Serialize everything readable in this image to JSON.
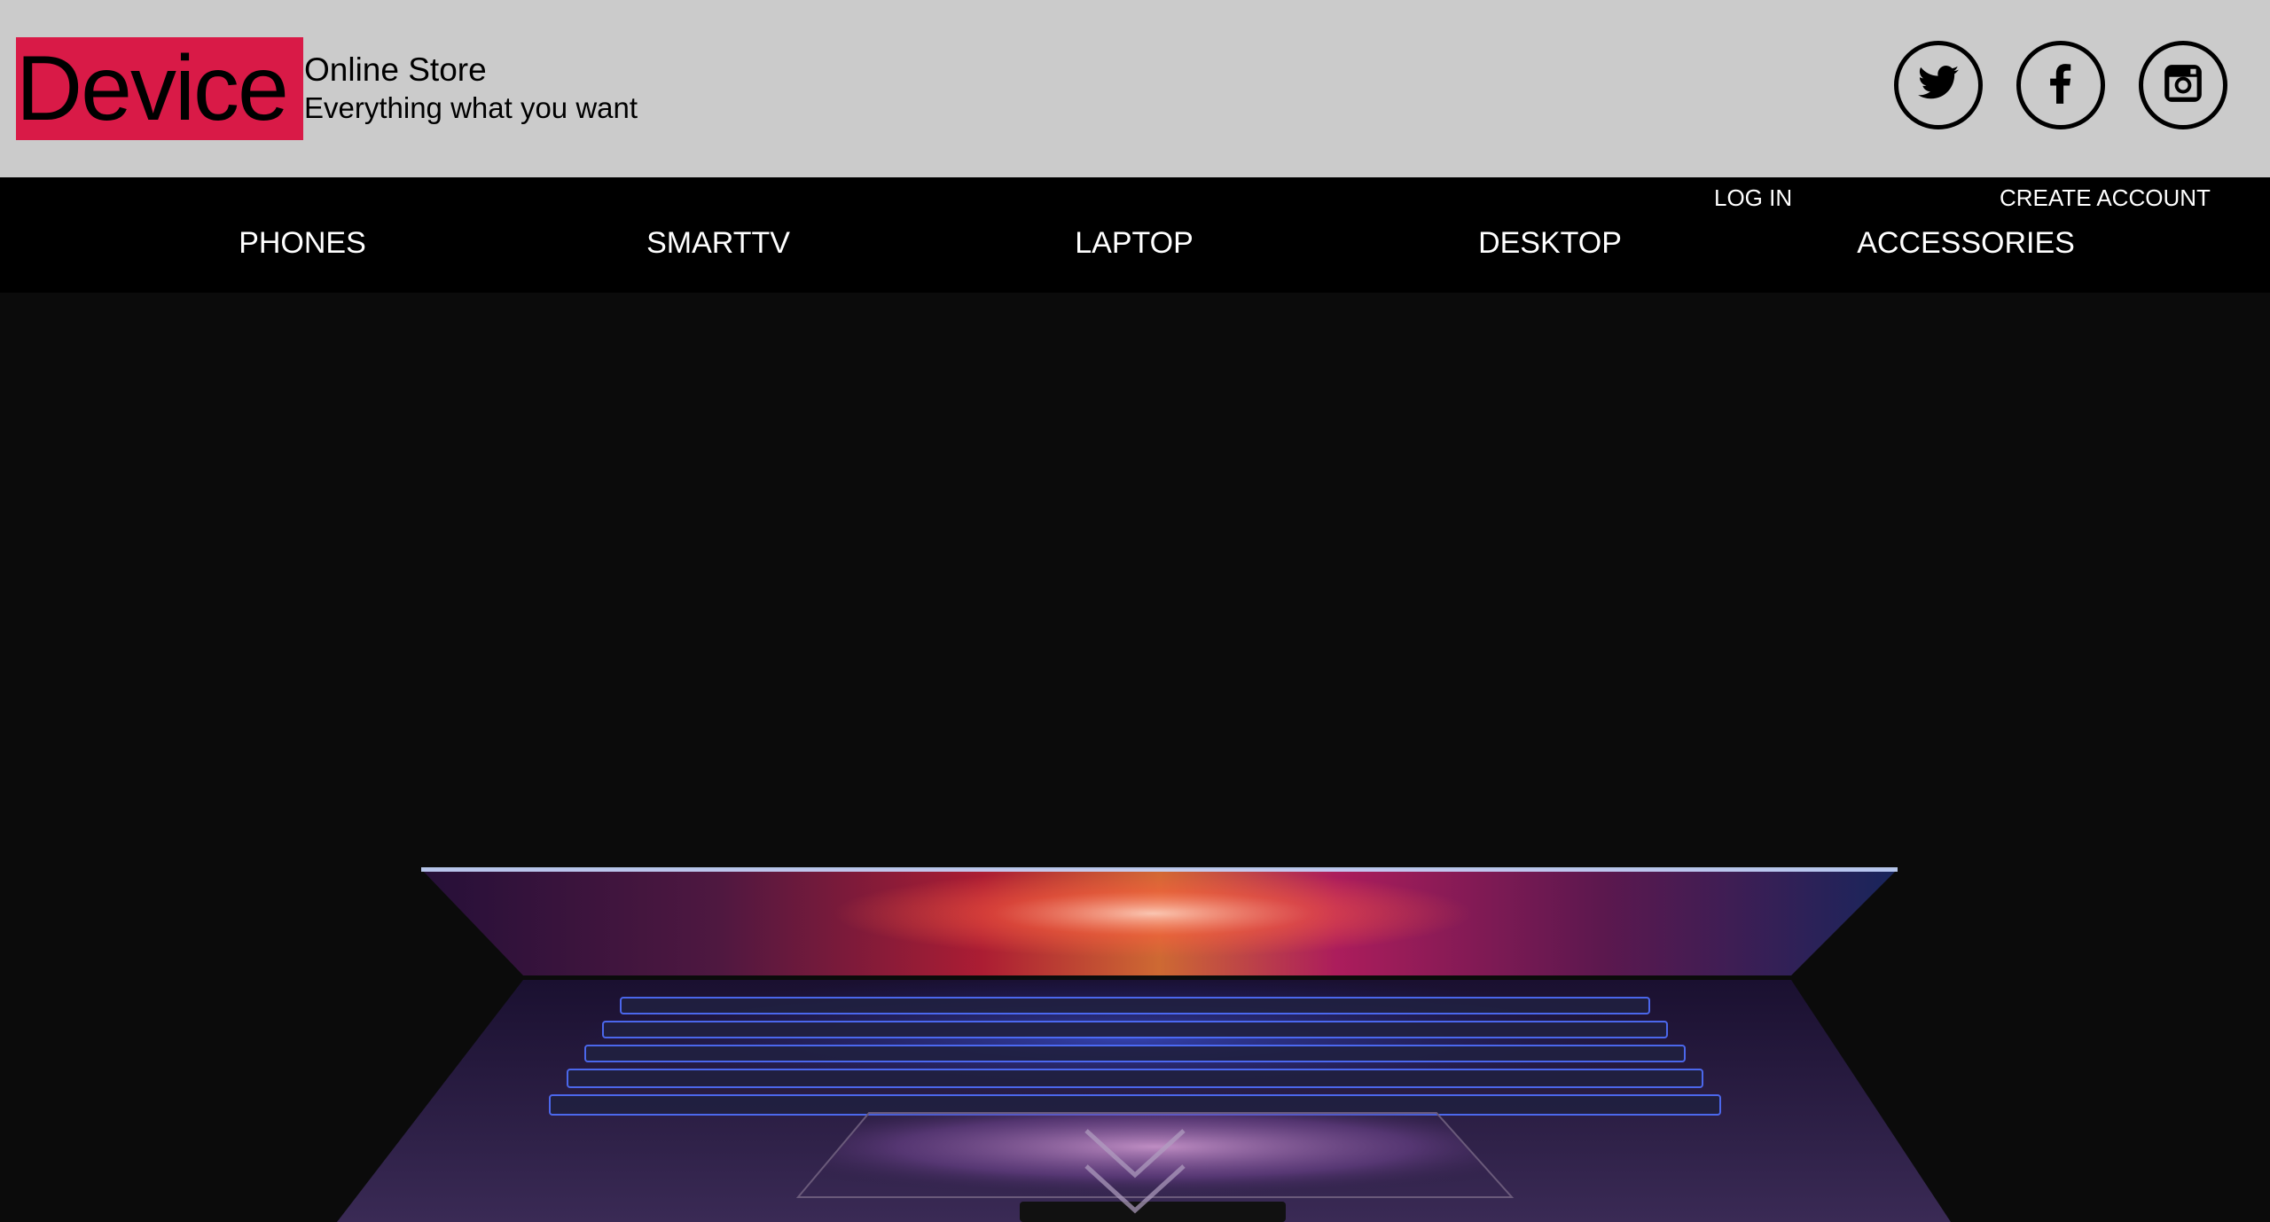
{
  "brand": {
    "logo": "Device",
    "title": "Online Store",
    "tagline": "Everything what you want",
    "accent_color": "#d91a47",
    "header_bg": "#cbcbcb"
  },
  "social": [
    {
      "name": "twitter",
      "icon": "twitter-icon"
    },
    {
      "name": "facebook",
      "icon": "facebook-icon"
    },
    {
      "name": "instagram",
      "icon": "instagram-icon"
    }
  ],
  "account": {
    "login": "LOG IN",
    "create": "CREATE ACCOUNT"
  },
  "nav": {
    "items": [
      "PHONES",
      "SMARTTV",
      "LAPTOP",
      "DESKTOP",
      "ACCESSORIES"
    ],
    "bg": "#000000",
    "text_color": "#ffffff"
  },
  "hero": {
    "image": "laptop-hero-image",
    "scroll_icon": "chevron-down-icon"
  }
}
